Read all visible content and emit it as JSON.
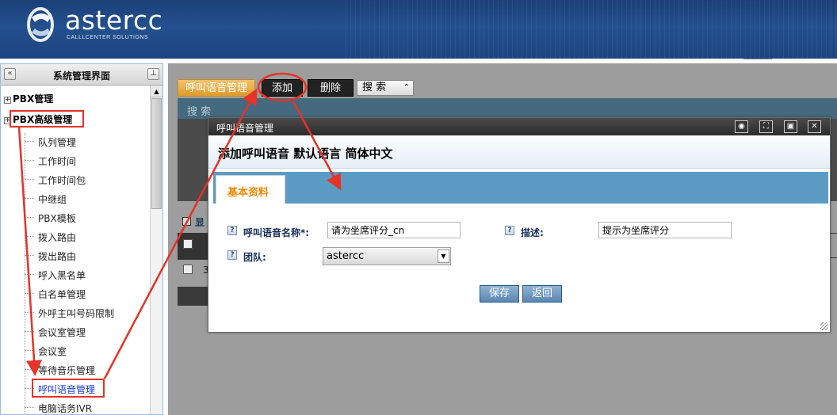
{
  "brand": {
    "name": "astercc",
    "tagline": "CALLLCENTER SOLUTIONS"
  },
  "left_panel": {
    "title": "系统管理界面",
    "collapse_icon": "double-chevron-left-icon",
    "pin_icon": "pin-icon",
    "roots": [
      "PBX管理",
      "PBX高级管理"
    ],
    "items": [
      "队列管理",
      "工作时间",
      "工作时间包",
      "中继组",
      "PBX模板",
      "拨入路由",
      "拨出路由",
      "呼入黑名单",
      "白名单管理",
      "外呼主叫号码限制",
      "会议室管理",
      "会议室",
      "等待音乐管理",
      "呼叫语音管理",
      "电脑话务IVR"
    ],
    "active_item": "呼叫语音管理",
    "link_color": "#1a3cd1"
  },
  "main": {
    "tabs": {
      "module": "呼叫语音管理",
      "add": "添加",
      "delete": "删除",
      "search": "搜 索"
    },
    "search_bar_label": "搜 索",
    "grid_title": "显",
    "row_text": "3"
  },
  "dialog": {
    "title": "呼叫语音管理",
    "heading": "添加呼叫语音 默认语言 简体中文",
    "tab": "基本资料",
    "fields": {
      "name_label": "呼叫语音名称*:",
      "name_value": "请为坐席评分_cn",
      "desc_label": "描述:",
      "desc_value": "提示为坐席评分",
      "team_label": "团队:",
      "team_value": "astercc"
    },
    "buttons": {
      "save": "保存",
      "back": "返回"
    },
    "controls": [
      "circle-icon",
      "maximize-icon",
      "restore-icon",
      "close-icon"
    ]
  },
  "colors": {
    "header_blue": "#1f4a86",
    "tab_orange": "#e3a33d",
    "dialog_tab_blue": "#5b9bc4",
    "annotation_red": "#e53327",
    "field_label_blue": "#172e5a"
  }
}
